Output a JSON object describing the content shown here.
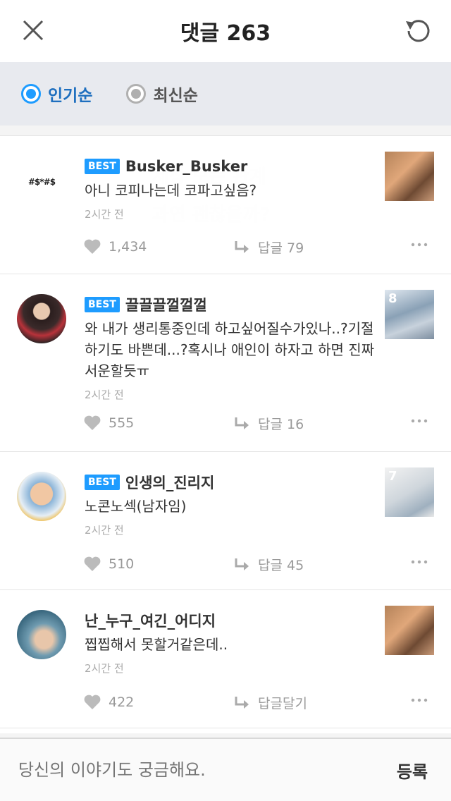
{
  "header": {
    "title": "댓글 263",
    "close_icon": "close-icon",
    "refresh_icon": "refresh-icon"
  },
  "sort": {
    "options": [
      {
        "label": "인기순",
        "selected": true
      },
      {
        "label": "최신순",
        "selected": false
      }
    ]
  },
  "comments": [
    {
      "badge": "BEST",
      "author": "Busker_Busker",
      "text": "아니 코피나는데 코파고싶음?",
      "time": "2시간 전",
      "likes": "1,434",
      "reply": "답글 79",
      "avatar_text": "#$*#$"
    },
    {
      "badge": "BEST",
      "author": "끌끌끌껄껄껄",
      "text": "와 내가 생리통중인데 하고싶어질수가있나..?기절하기도 바쁜데...?혹시나 애인이 하자고 하면 진짜 서운할듯ㅠ",
      "time": "2시간 전",
      "likes": "555",
      "reply": "답글 16",
      "thumb_text": "8"
    },
    {
      "badge": "BEST",
      "author": "인생의_진리지",
      "text": "노콘노섹(남자임)",
      "time": "2시간 전",
      "likes": "510",
      "reply": "답글 45",
      "thumb_text": "7"
    },
    {
      "badge": "",
      "author": "난_누구_여긴_어디지",
      "text": "찝찝해서 못할거같은데..",
      "time": "2시간 전",
      "likes": "422",
      "reply": "답글달기"
    }
  ],
  "input": {
    "placeholder": "당신의 이야기도 궁금해요.",
    "submit": "등록"
  },
  "colors": {
    "accent": "#1e9cff",
    "sortbar_bg": "#e8eaef"
  }
}
